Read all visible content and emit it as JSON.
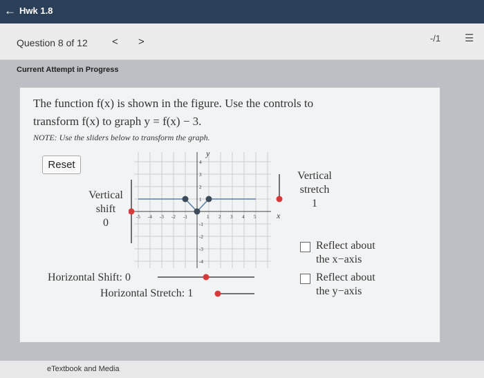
{
  "header": {
    "back_icon": "arrow-left-icon",
    "title": "Hwk 1.8"
  },
  "question_bar": {
    "label": "Question 8 of 12",
    "prev": "<",
    "next": ">",
    "score": "-/1",
    "list_icon": "list-icon"
  },
  "status": "Current Attempt in Progress",
  "problem": {
    "line1": "The function f(x) is shown in the figure. Use the controls to",
    "line2": "transform f(x) to graph y = f(x) − 3.",
    "note": "NOTE: Use the sliders below to transform the graph."
  },
  "controls": {
    "reset": "Reset",
    "vshift_label": "Vertical",
    "vshift_label2": "shift",
    "vshift_value": "0",
    "vstretch_label": "Vertical",
    "vstretch_label2": "stretch",
    "vstretch_value": "1",
    "hshift": "Horizontal Shift: 0",
    "hstretch": "Horizontal Stretch: 1",
    "reflect_x": "Reflect about",
    "reflect_x2": "the x−axis",
    "reflect_y": "Reflect about",
    "reflect_y2": "the y−axis"
  },
  "graph": {
    "x_label": "x",
    "y_label": "y",
    "x_ticks": [
      "-5",
      "-4",
      "-3",
      "-2",
      "-1",
      "1",
      "2",
      "3",
      "4",
      "5"
    ],
    "y_ticks": [
      "4",
      "3",
      "2",
      "1",
      "-1",
      "-2",
      "-3",
      "-4"
    ],
    "function_points": [
      [
        -5,
        1
      ],
      [
        -1,
        1
      ],
      [
        0,
        0
      ],
      [
        1,
        1
      ],
      [
        5,
        1
      ]
    ],
    "accent": "#d73a3a",
    "curve_color": "#5b7fa6"
  },
  "footer": "eTextbook and Media"
}
